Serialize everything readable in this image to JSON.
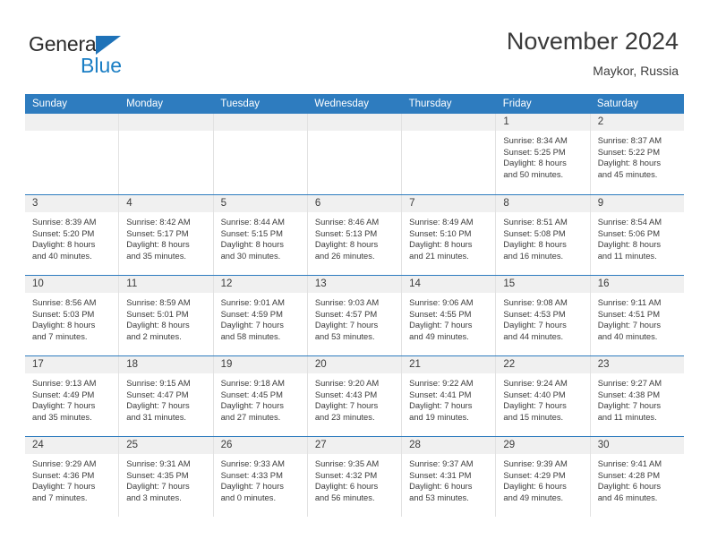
{
  "logo": {
    "primary_text": "General",
    "secondary_text": "Blue",
    "primary_color": "#2b2b2b",
    "secondary_color": "#1a7ec4",
    "triangle_color": "#1e72b8"
  },
  "header": {
    "title": "November 2024",
    "subtitle": "Maykor, Russia"
  },
  "theme": {
    "header_bar_color": "#2e7cbf",
    "day_number_band_color": "#f0f0f0",
    "cell_border_color": "#e2e2e2",
    "text_color": "#3b3b3b"
  },
  "weekdays": [
    "Sunday",
    "Monday",
    "Tuesday",
    "Wednesday",
    "Thursday",
    "Friday",
    "Saturday"
  ],
  "weeks": [
    [
      {
        "day": "",
        "empty": true,
        "sunrise": "",
        "sunset": "",
        "daylight_line1": "",
        "daylight_line2": ""
      },
      {
        "day": "",
        "empty": true,
        "sunrise": "",
        "sunset": "",
        "daylight_line1": "",
        "daylight_line2": ""
      },
      {
        "day": "",
        "empty": true,
        "sunrise": "",
        "sunset": "",
        "daylight_line1": "",
        "daylight_line2": ""
      },
      {
        "day": "",
        "empty": true,
        "sunrise": "",
        "sunset": "",
        "daylight_line1": "",
        "daylight_line2": ""
      },
      {
        "day": "",
        "empty": true,
        "sunrise": "",
        "sunset": "",
        "daylight_line1": "",
        "daylight_line2": ""
      },
      {
        "day": "1",
        "empty": false,
        "sunrise": "Sunrise: 8:34 AM",
        "sunset": "Sunset: 5:25 PM",
        "daylight_line1": "Daylight: 8 hours",
        "daylight_line2": "and 50 minutes."
      },
      {
        "day": "2",
        "empty": false,
        "sunrise": "Sunrise: 8:37 AM",
        "sunset": "Sunset: 5:22 PM",
        "daylight_line1": "Daylight: 8 hours",
        "daylight_line2": "and 45 minutes."
      }
    ],
    [
      {
        "day": "3",
        "empty": false,
        "sunrise": "Sunrise: 8:39 AM",
        "sunset": "Sunset: 5:20 PM",
        "daylight_line1": "Daylight: 8 hours",
        "daylight_line2": "and 40 minutes."
      },
      {
        "day": "4",
        "empty": false,
        "sunrise": "Sunrise: 8:42 AM",
        "sunset": "Sunset: 5:17 PM",
        "daylight_line1": "Daylight: 8 hours",
        "daylight_line2": "and 35 minutes."
      },
      {
        "day": "5",
        "empty": false,
        "sunrise": "Sunrise: 8:44 AM",
        "sunset": "Sunset: 5:15 PM",
        "daylight_line1": "Daylight: 8 hours",
        "daylight_line2": "and 30 minutes."
      },
      {
        "day": "6",
        "empty": false,
        "sunrise": "Sunrise: 8:46 AM",
        "sunset": "Sunset: 5:13 PM",
        "daylight_line1": "Daylight: 8 hours",
        "daylight_line2": "and 26 minutes."
      },
      {
        "day": "7",
        "empty": false,
        "sunrise": "Sunrise: 8:49 AM",
        "sunset": "Sunset: 5:10 PM",
        "daylight_line1": "Daylight: 8 hours",
        "daylight_line2": "and 21 minutes."
      },
      {
        "day": "8",
        "empty": false,
        "sunrise": "Sunrise: 8:51 AM",
        "sunset": "Sunset: 5:08 PM",
        "daylight_line1": "Daylight: 8 hours",
        "daylight_line2": "and 16 minutes."
      },
      {
        "day": "9",
        "empty": false,
        "sunrise": "Sunrise: 8:54 AM",
        "sunset": "Sunset: 5:06 PM",
        "daylight_line1": "Daylight: 8 hours",
        "daylight_line2": "and 11 minutes."
      }
    ],
    [
      {
        "day": "10",
        "empty": false,
        "sunrise": "Sunrise: 8:56 AM",
        "sunset": "Sunset: 5:03 PM",
        "daylight_line1": "Daylight: 8 hours",
        "daylight_line2": "and 7 minutes."
      },
      {
        "day": "11",
        "empty": false,
        "sunrise": "Sunrise: 8:59 AM",
        "sunset": "Sunset: 5:01 PM",
        "daylight_line1": "Daylight: 8 hours",
        "daylight_line2": "and 2 minutes."
      },
      {
        "day": "12",
        "empty": false,
        "sunrise": "Sunrise: 9:01 AM",
        "sunset": "Sunset: 4:59 PM",
        "daylight_line1": "Daylight: 7 hours",
        "daylight_line2": "and 58 minutes."
      },
      {
        "day": "13",
        "empty": false,
        "sunrise": "Sunrise: 9:03 AM",
        "sunset": "Sunset: 4:57 PM",
        "daylight_line1": "Daylight: 7 hours",
        "daylight_line2": "and 53 minutes."
      },
      {
        "day": "14",
        "empty": false,
        "sunrise": "Sunrise: 9:06 AM",
        "sunset": "Sunset: 4:55 PM",
        "daylight_line1": "Daylight: 7 hours",
        "daylight_line2": "and 49 minutes."
      },
      {
        "day": "15",
        "empty": false,
        "sunrise": "Sunrise: 9:08 AM",
        "sunset": "Sunset: 4:53 PM",
        "daylight_line1": "Daylight: 7 hours",
        "daylight_line2": "and 44 minutes."
      },
      {
        "day": "16",
        "empty": false,
        "sunrise": "Sunrise: 9:11 AM",
        "sunset": "Sunset: 4:51 PM",
        "daylight_line1": "Daylight: 7 hours",
        "daylight_line2": "and 40 minutes."
      }
    ],
    [
      {
        "day": "17",
        "empty": false,
        "sunrise": "Sunrise: 9:13 AM",
        "sunset": "Sunset: 4:49 PM",
        "daylight_line1": "Daylight: 7 hours",
        "daylight_line2": "and 35 minutes."
      },
      {
        "day": "18",
        "empty": false,
        "sunrise": "Sunrise: 9:15 AM",
        "sunset": "Sunset: 4:47 PM",
        "daylight_line1": "Daylight: 7 hours",
        "daylight_line2": "and 31 minutes."
      },
      {
        "day": "19",
        "empty": false,
        "sunrise": "Sunrise: 9:18 AM",
        "sunset": "Sunset: 4:45 PM",
        "daylight_line1": "Daylight: 7 hours",
        "daylight_line2": "and 27 minutes."
      },
      {
        "day": "20",
        "empty": false,
        "sunrise": "Sunrise: 9:20 AM",
        "sunset": "Sunset: 4:43 PM",
        "daylight_line1": "Daylight: 7 hours",
        "daylight_line2": "and 23 minutes."
      },
      {
        "day": "21",
        "empty": false,
        "sunrise": "Sunrise: 9:22 AM",
        "sunset": "Sunset: 4:41 PM",
        "daylight_line1": "Daylight: 7 hours",
        "daylight_line2": "and 19 minutes."
      },
      {
        "day": "22",
        "empty": false,
        "sunrise": "Sunrise: 9:24 AM",
        "sunset": "Sunset: 4:40 PM",
        "daylight_line1": "Daylight: 7 hours",
        "daylight_line2": "and 15 minutes."
      },
      {
        "day": "23",
        "empty": false,
        "sunrise": "Sunrise: 9:27 AM",
        "sunset": "Sunset: 4:38 PM",
        "daylight_line1": "Daylight: 7 hours",
        "daylight_line2": "and 11 minutes."
      }
    ],
    [
      {
        "day": "24",
        "empty": false,
        "sunrise": "Sunrise: 9:29 AM",
        "sunset": "Sunset: 4:36 PM",
        "daylight_line1": "Daylight: 7 hours",
        "daylight_line2": "and 7 minutes."
      },
      {
        "day": "25",
        "empty": false,
        "sunrise": "Sunrise: 9:31 AM",
        "sunset": "Sunset: 4:35 PM",
        "daylight_line1": "Daylight: 7 hours",
        "daylight_line2": "and 3 minutes."
      },
      {
        "day": "26",
        "empty": false,
        "sunrise": "Sunrise: 9:33 AM",
        "sunset": "Sunset: 4:33 PM",
        "daylight_line1": "Daylight: 7 hours",
        "daylight_line2": "and 0 minutes."
      },
      {
        "day": "27",
        "empty": false,
        "sunrise": "Sunrise: 9:35 AM",
        "sunset": "Sunset: 4:32 PM",
        "daylight_line1": "Daylight: 6 hours",
        "daylight_line2": "and 56 minutes."
      },
      {
        "day": "28",
        "empty": false,
        "sunrise": "Sunrise: 9:37 AM",
        "sunset": "Sunset: 4:31 PM",
        "daylight_line1": "Daylight: 6 hours",
        "daylight_line2": "and 53 minutes."
      },
      {
        "day": "29",
        "empty": false,
        "sunrise": "Sunrise: 9:39 AM",
        "sunset": "Sunset: 4:29 PM",
        "daylight_line1": "Daylight: 6 hours",
        "daylight_line2": "and 49 minutes."
      },
      {
        "day": "30",
        "empty": false,
        "sunrise": "Sunrise: 9:41 AM",
        "sunset": "Sunset: 4:28 PM",
        "daylight_line1": "Daylight: 6 hours",
        "daylight_line2": "and 46 minutes."
      }
    ]
  ]
}
